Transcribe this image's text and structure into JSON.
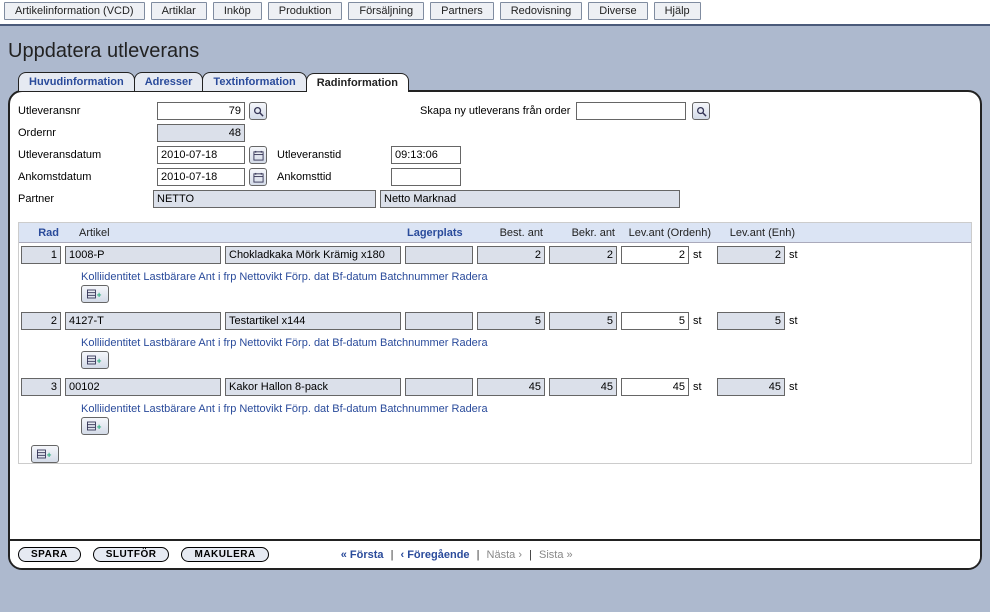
{
  "menu": [
    "Artikelinformation (VCD)",
    "Artiklar",
    "Inköp",
    "Produktion",
    "Försäljning",
    "Partners",
    "Redovisning",
    "Diverse",
    "Hjälp"
  ],
  "pageTitle": "Uppdatera utleverans",
  "tabs": [
    {
      "label": "Huvudinformation",
      "active": false
    },
    {
      "label": "Adresser",
      "active": false
    },
    {
      "label": "Textinformation",
      "active": false
    },
    {
      "label": "Radinformation",
      "active": true
    }
  ],
  "header": {
    "utleveransnr_label": "Utleveransnr",
    "utleveransnr": "79",
    "ordernr_label": "Ordernr",
    "ordernr": "48",
    "utlevdatum_label": "Utleveransdatum",
    "utlevdatum": "2010-07-18",
    "utlevtid_label": "Utleveranstid",
    "utlevtid": "09:13:06",
    "ankdatum_label": "Ankomstdatum",
    "ankdatum": "2010-07-18",
    "anktid_label": "Ankomsttid",
    "anktid": "",
    "partner_label": "Partner",
    "partner_code": "NETTO",
    "partner_name": "Netto Marknad",
    "create_label": "Skapa ny utleverans från order",
    "create_value": ""
  },
  "columns": {
    "rad": "Rad",
    "artikel": "Artikel",
    "lagerplats": "Lagerplats",
    "best": "Best. ant",
    "bekr": "Bekr. ant",
    "lev1": "Lev.ant (Ordenh)",
    "lev2": "Lev.ant (Enh)"
  },
  "unit": "st",
  "rows": [
    {
      "rad": "1",
      "art": "1008-P",
      "desc": "Chokladkaka Mörk Krämig x180",
      "lager": "",
      "best": "2",
      "bekr": "2",
      "lev1": "2",
      "lev2": "2"
    },
    {
      "rad": "2",
      "art": "4127-T",
      "desc": "Testartikel x144",
      "lager": "",
      "best": "5",
      "bekr": "5",
      "lev1": "5",
      "lev2": "5"
    },
    {
      "rad": "3",
      "art": "00102",
      "desc": "Kakor Hallon 8-pack",
      "lager": "",
      "best": "45",
      "bekr": "45",
      "lev1": "45",
      "lev2": "45"
    }
  ],
  "subHeader": "Kolliidentitet Lastbärare Ant i frp Nettovikt Förp. dat Bf-datum Batchnummer Radera",
  "buttons": {
    "spara": "SPARA",
    "slutfor": "SLUTFÖR",
    "makulera": "MAKULERA"
  },
  "pager": {
    "first": "« Första",
    "prev": "‹ Föregående",
    "next": "Nästa ›",
    "last": "Sista »"
  }
}
